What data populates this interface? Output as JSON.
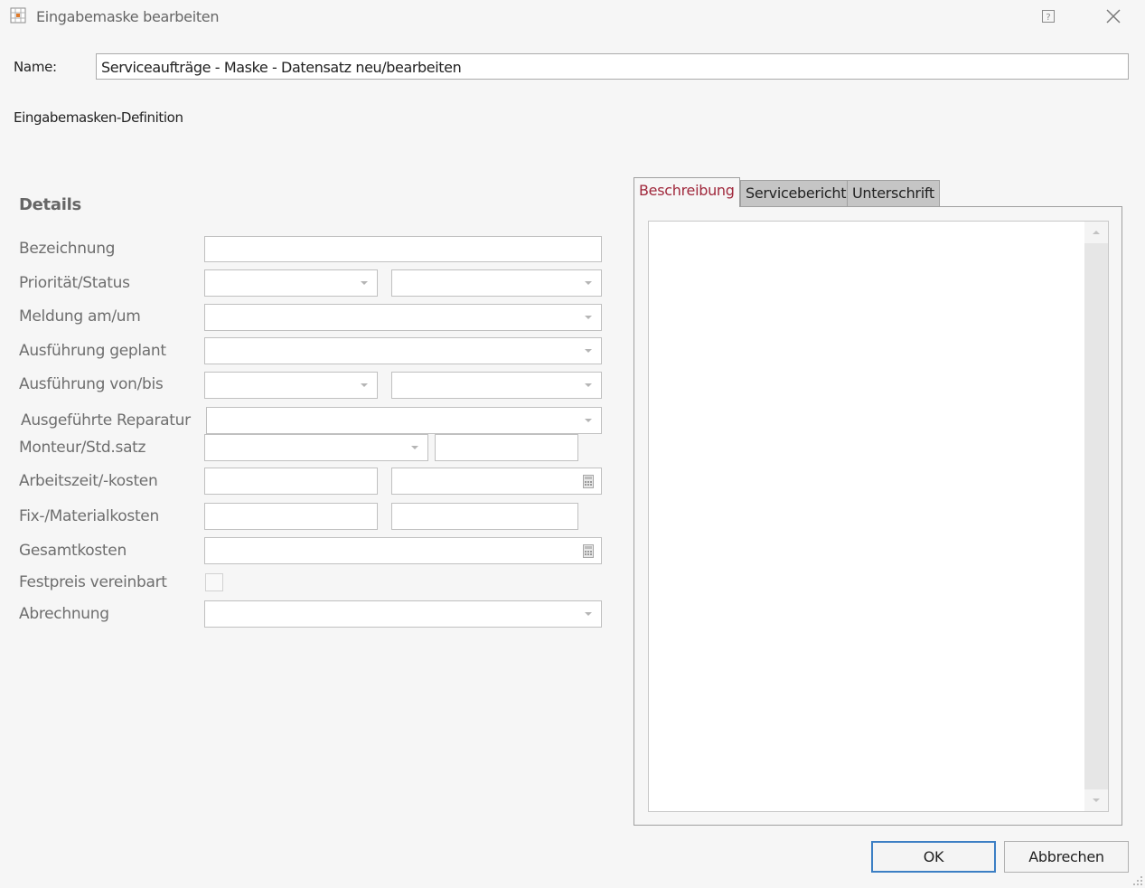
{
  "window": {
    "title": "Eingabemaske bearbeiten",
    "icons": [
      "form-icon",
      "help-icon",
      "close-icon"
    ]
  },
  "name_field": {
    "label": "Name:",
    "value": "Serviceaufträge - Maske - Datensatz neu/bearbeiten"
  },
  "definition_label": "Eingabemasken-Definition",
  "details": {
    "title": "Details",
    "fields": {
      "bezeichnung": "Bezeichnung",
      "prioritaet_status": "Priorität/Status",
      "meldung": "Meldung am/um",
      "ausfuehrung_geplant": "Ausführung geplant",
      "ausfuehrung_von_bis": "Ausführung von/bis",
      "ausgefuehrte_reparatur": "Ausgeführte Reparatur",
      "monteur": "Monteur/Std.satz",
      "arbeitszeit": "Arbeitszeit/-kosten",
      "fixkosten": "Fix-/Materialkosten",
      "gesamtkosten": "Gesamtkosten",
      "festpreis": "Festpreis vereinbart",
      "abrechnung": "Abrechnung"
    },
    "festpreis_checked": false
  },
  "tabs": {
    "beschreibung": "Beschreibung",
    "servicebericht": "Servicebericht",
    "unterschrift": "Unterschrift",
    "active": "Beschreibung"
  },
  "buttons": {
    "ok": "OK",
    "cancel": "Abbrechen"
  },
  "colors": {
    "background": "#f6f6f6",
    "active_tab_text": "#a0283c",
    "focus_border": "#3c7fc4",
    "label_text": "#6e6e6e"
  }
}
